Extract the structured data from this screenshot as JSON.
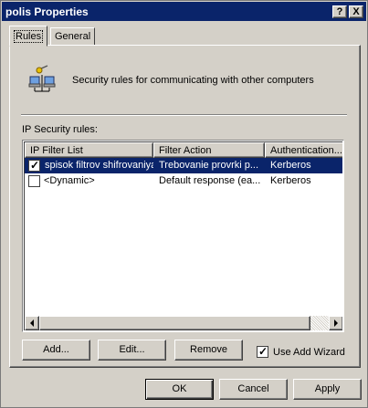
{
  "window": {
    "title": "polis Properties",
    "help_glyph": "?",
    "close_glyph": "X"
  },
  "tabs": [
    {
      "label": "Rules",
      "active": true
    },
    {
      "label": "General",
      "active": false
    }
  ],
  "description": "Security rules for communicating with other computers",
  "list_label": "IP Security rules:",
  "columns": [
    "IP Filter List",
    "Filter Action",
    "Authentication..."
  ],
  "rows": [
    {
      "checked": true,
      "selected": true,
      "filter_list": "spisok filtrov shifrovaniya",
      "filter_action": "Trebovanie provrki p...",
      "authentication": "Kerberos"
    },
    {
      "checked": false,
      "selected": false,
      "filter_list": "<Dynamic>",
      "filter_action": "Default response (ea...",
      "authentication": "Kerberos"
    }
  ],
  "buttons": {
    "add": "Add...",
    "edit": "Edit...",
    "remove": "Remove"
  },
  "use_add_wizard": {
    "label": "Use Add Wizard",
    "checked": true
  },
  "footer": {
    "ok": "OK",
    "cancel": "Cancel",
    "apply": "Apply"
  },
  "colors": {
    "titlebar": "#0a246a",
    "face": "#d4d0c8",
    "selection": "#0a246a"
  }
}
